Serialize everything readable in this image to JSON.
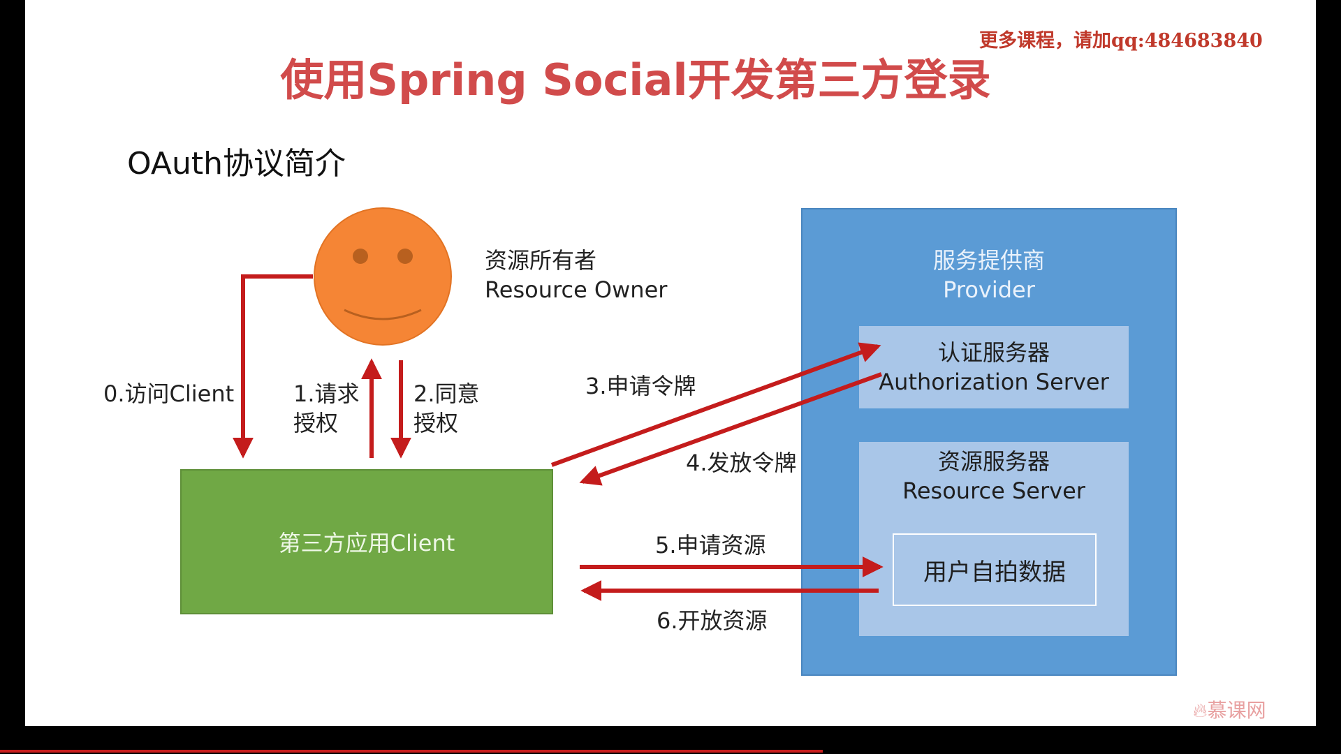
{
  "watermark_top": "更多课程，请加qq:484683840",
  "title": "使用Spring Social开发第三方登录",
  "subtitle": "OAuth协议简介",
  "resource_owner": {
    "name_cn": "资源所有者",
    "name_en": "Resource Owner"
  },
  "client": {
    "label": "第三方应用Client"
  },
  "provider": {
    "title_cn": "服务提供商",
    "title_en": "Provider",
    "auth_server_cn": "认证服务器",
    "auth_server_en": "Authorization Server",
    "resource_server_cn": "资源服务器",
    "resource_server_en": "Resource Server",
    "selfie_data": "用户自拍数据"
  },
  "steps": {
    "step0": "0.访问Client",
    "step1_line1": "1.请求",
    "step1_line2": "授权",
    "step2_line1": "2.同意",
    "step2_line2": "授权",
    "step3": "3.申请令牌",
    "step4": "4.发放令牌",
    "step5": "5.申请资源",
    "step6": "6.开放资源"
  },
  "logo": "慕课网",
  "colors": {
    "title": "#d14b4b",
    "arrow": "#c41c1c",
    "provider": "#5b9bd5",
    "inner_box": "#a9c6e8",
    "client": "#70a845",
    "face": "#f58535"
  }
}
